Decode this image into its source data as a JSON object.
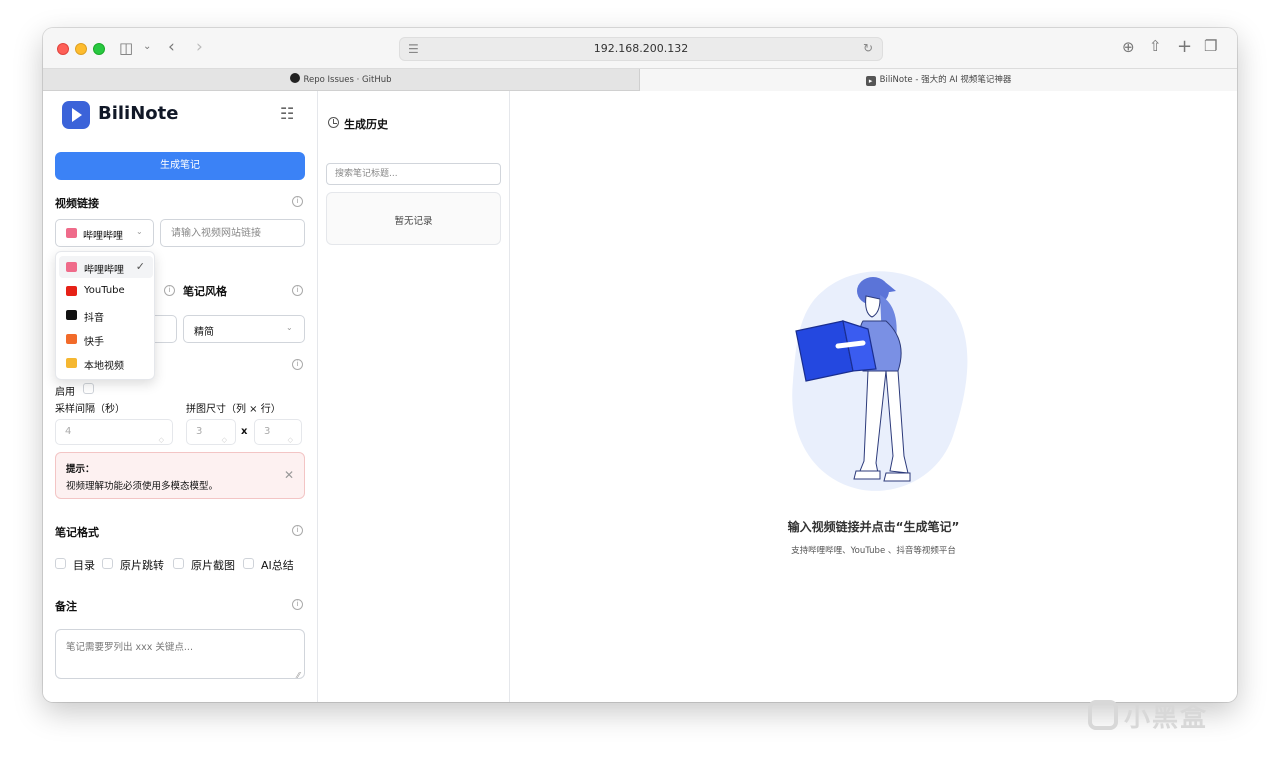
{
  "browser": {
    "url": "192.168.200.132",
    "tabs": [
      {
        "label": "Repo Issues · GitHub"
      },
      {
        "label": "BiliNote - 强大的 AI 视频笔记神器"
      }
    ]
  },
  "sidebar": {
    "app_name": "BiliNote",
    "generate_button": "生成笔记",
    "video_link": {
      "title": "视频链接",
      "selected_platform": "哔哩哔哩",
      "url_placeholder": "请输入视频网站链接"
    },
    "platform_options": [
      {
        "label": "哔哩哔哩",
        "selected": true,
        "color": "#ef6b8a"
      },
      {
        "label": "YouTube",
        "selected": false,
        "color": "#e62117"
      },
      {
        "label": "抖音",
        "selected": false,
        "color": "#111111"
      },
      {
        "label": "快手",
        "selected": false,
        "color": "#f26b2a"
      },
      {
        "label": "本地视频",
        "selected": false,
        "color": "#f5b731"
      }
    ],
    "note_style": {
      "title": "笔记风格",
      "value": "精简"
    },
    "video_understanding": {
      "enable_label": "启用",
      "interval_label": "采样间隔（秒）",
      "interval_value": "4",
      "grid_label": "拼图尺寸（列 × 行）",
      "grid_cols": "3",
      "grid_x": "x",
      "grid_rows": "3"
    },
    "alert": {
      "title": "提示：",
      "text": "视频理解功能必须使用多模态模型。"
    },
    "note_format": {
      "title": "笔记格式",
      "options": [
        "目录",
        "原片跳转",
        "原片截图",
        "AI总结"
      ]
    },
    "remarks": {
      "title": "备注",
      "placeholder": "笔记需要罗列出 xxx 关键点..."
    }
  },
  "history": {
    "title": "生成历史",
    "search_placeholder": "搜索笔记标题...",
    "empty_text": "暂无记录"
  },
  "main": {
    "empty_title": "输入视频链接并点击“生成笔记”",
    "empty_subtitle": "支持哔哩哔哩、YouTube 、抖音等视频平台"
  },
  "watermark": "小黑盒",
  "colors": {
    "primary": "#3b82f6",
    "logo": "#3b63d9",
    "alert_bg": "#fdf1f1"
  }
}
